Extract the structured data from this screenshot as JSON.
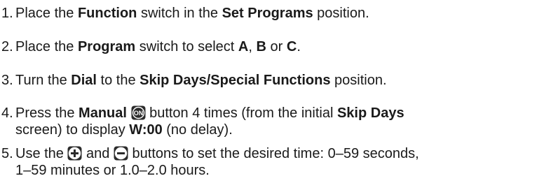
{
  "steps": [
    {
      "number": "1.",
      "lines": [
        [
          {
            "t": "text",
            "v": "Place the "
          },
          {
            "t": "bold",
            "v": "Function"
          },
          {
            "t": "text",
            "v": " switch in the "
          },
          {
            "t": "bold",
            "v": "Set Programs"
          },
          {
            "t": "text",
            "v": " position."
          }
        ]
      ]
    },
    {
      "number": "2.",
      "lines": [
        [
          {
            "t": "text",
            "v": "Place the "
          },
          {
            "t": "bold",
            "v": "Program"
          },
          {
            "t": "text",
            "v": " switch to select "
          },
          {
            "t": "bold",
            "v": "A"
          },
          {
            "t": "text",
            "v": ", "
          },
          {
            "t": "bold",
            "v": "B"
          },
          {
            "t": "text",
            "v": " or "
          },
          {
            "t": "bold",
            "v": "C"
          },
          {
            "t": "text",
            "v": "."
          }
        ]
      ]
    },
    {
      "number": "3.",
      "lines": [
        [
          {
            "t": "text",
            "v": "Turn the "
          },
          {
            "t": "bold",
            "v": "Dial"
          },
          {
            "t": "text",
            "v": " to the "
          },
          {
            "t": "bold",
            "v": "Skip Days/Special Functions"
          },
          {
            "t": "text",
            "v": " position."
          }
        ]
      ]
    },
    {
      "number": "4.",
      "lines": [
        [
          {
            "t": "text",
            "v": "Press the "
          },
          {
            "t": "bold",
            "v": "Manual"
          },
          {
            "t": "text",
            "v": " "
          },
          {
            "t": "icon",
            "v": "on-button-icon",
            "label": "ON"
          },
          {
            "t": "text",
            "v": " button 4 times (from the initial "
          },
          {
            "t": "bold",
            "v": "Skip Days"
          }
        ],
        [
          {
            "t": "text",
            "v": "screen) to display "
          },
          {
            "t": "bold",
            "v": "W:00"
          },
          {
            "t": "text",
            "v": " (no delay)."
          }
        ]
      ]
    },
    {
      "number": "5.",
      "lines": [
        [
          {
            "t": "text",
            "v": "Use the "
          },
          {
            "t": "icon",
            "v": "plus-button-icon"
          },
          {
            "t": "text",
            "v": " and "
          },
          {
            "t": "icon",
            "v": "minus-button-icon"
          },
          {
            "t": "text",
            "v": " buttons to set the desired time: 0–59 seconds,"
          }
        ],
        [
          {
            "t": "text",
            "v": "1–59 minutes or 1.0–2.0 hours."
          }
        ]
      ]
    }
  ]
}
